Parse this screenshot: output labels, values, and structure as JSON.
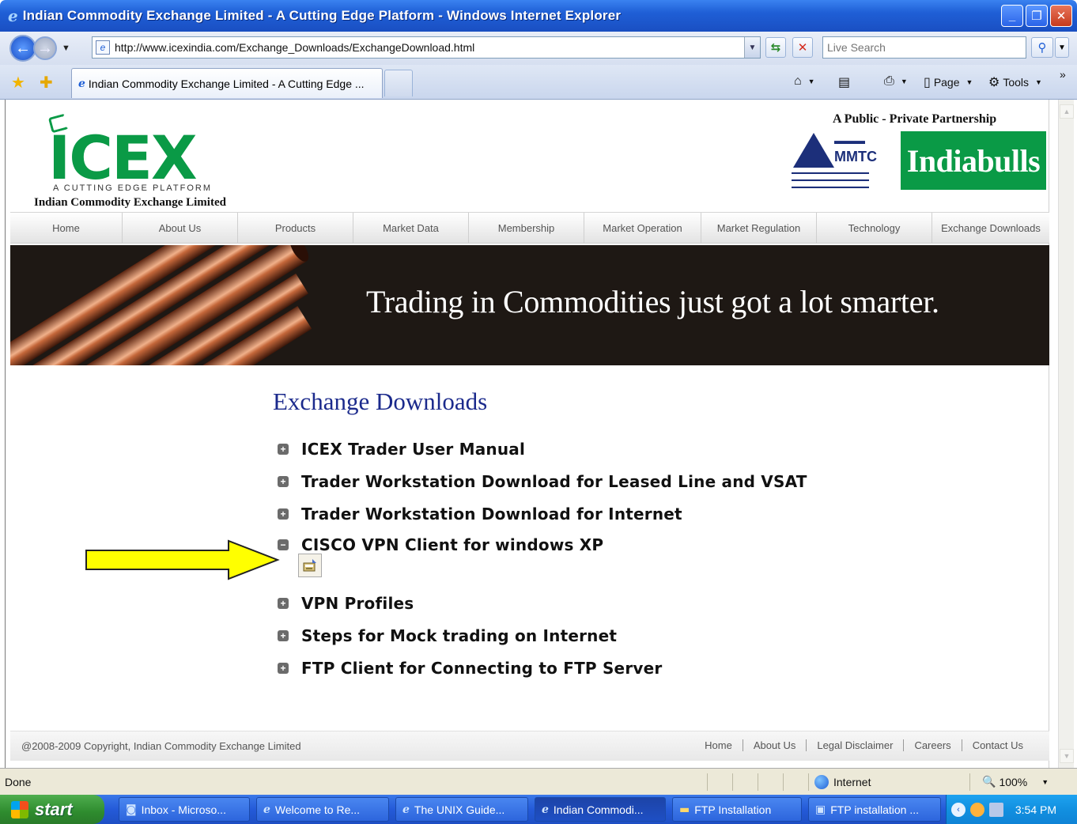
{
  "window": {
    "title": "Indian Commodity Exchange Limited - A Cutting Edge Platform - Windows Internet Explorer"
  },
  "address_bar": {
    "url": "http://www.icexindia.com/Exchange_Downloads/ExchangeDownload.html"
  },
  "search": {
    "placeholder": "Live Search"
  },
  "tab": {
    "label": "Indian Commodity Exchange Limited - A Cutting Edge ..."
  },
  "commands": {
    "page_label": "Page",
    "tools_label": "Tools"
  },
  "site": {
    "logo_text": "ICEX",
    "tagline": "A CUTTING EDGE PLATFORM",
    "company_name": "Indian Commodity Exchange Limited",
    "partnership": "A Public - Private Partnership",
    "partner_logo": "Indiabulls",
    "mmtc_logo": "MMTC"
  },
  "main_nav": [
    {
      "label": "Home"
    },
    {
      "label": "About Us"
    },
    {
      "label": "Products"
    },
    {
      "label": "Market Data"
    },
    {
      "label": "Membership"
    },
    {
      "label": "Market Operation"
    },
    {
      "label": "Market Regulation"
    },
    {
      "label": "Technology"
    },
    {
      "label": "Exchange Downloads"
    }
  ],
  "banner": {
    "text": "Trading in Commodities just got a lot smarter."
  },
  "content": {
    "heading": "Exchange Downloads",
    "items": [
      {
        "label": "ICEX Trader User Manual",
        "expanded": false
      },
      {
        "label": "Trader Workstation Download for Leased Line and VSAT",
        "expanded": false
      },
      {
        "label": "Trader Workstation Download for Internet",
        "expanded": false
      },
      {
        "label": "CISCO VPN Client for windows XP",
        "expanded": true
      },
      {
        "label": "VPN Profiles",
        "expanded": false
      },
      {
        "label": "Steps for Mock trading on Internet",
        "expanded": false
      },
      {
        "label": "FTP Client for Connecting to FTP Server",
        "expanded": false
      }
    ],
    "expand_symbol": "+",
    "collapse_symbol": "−"
  },
  "footer": {
    "copyright": "@2008-2009 Copyright, Indian Commodity Exchange Limited",
    "links": [
      {
        "label": "Home"
      },
      {
        "label": "About Us"
      },
      {
        "label": "Legal Disclaimer"
      },
      {
        "label": "Careers"
      },
      {
        "label": "Contact Us"
      }
    ]
  },
  "status_bar": {
    "status": "Done",
    "zone": "Internet",
    "zoom": "100%"
  },
  "taskbar": {
    "start_label": "start",
    "buttons": [
      {
        "label": "Inbox - Microso..."
      },
      {
        "label": "Welcome to Re..."
      },
      {
        "label": "The UNIX Guide..."
      },
      {
        "label": "Indian Commodi..."
      },
      {
        "label": "FTP Installation"
      },
      {
        "label": "FTP installation ..."
      }
    ],
    "clock": "3:54 PM"
  },
  "colors": {
    "icex_green": "#0a9a46",
    "heading_blue": "#1b2a8c",
    "arrow_yellow": "#ffff00",
    "xp_blue": "#245ad8"
  }
}
